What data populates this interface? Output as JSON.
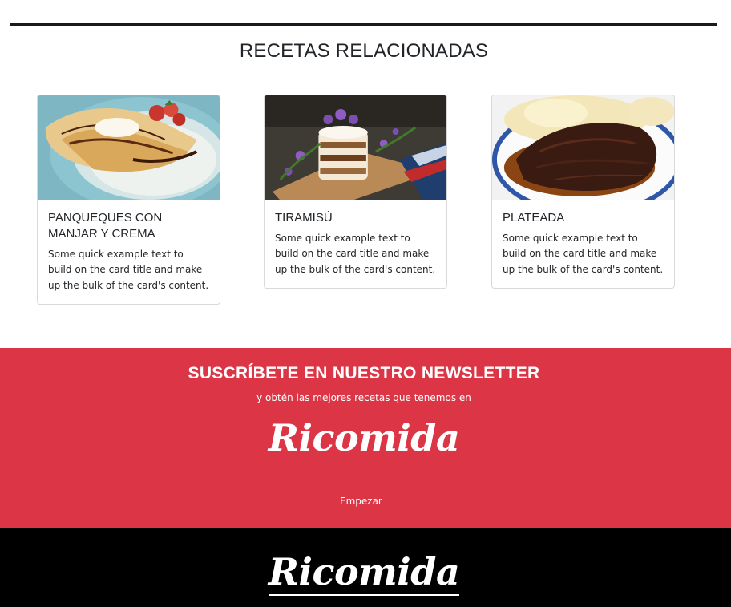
{
  "section": {
    "title": "RECETAS RELACIONADAS"
  },
  "cards": [
    {
      "title": "PANQUEQUES CON MANJAR Y CREMA",
      "text": "Some quick example text to build on the card title and make up the bulk of the card's content."
    },
    {
      "title": "TIRAMISÚ",
      "text": "Some quick example text to build on the card title and make up the bulk of the card's content."
    },
    {
      "title": "PLATEADA",
      "text": "Some quick example text to build on the card title and make up the bulk of the card's content."
    }
  ],
  "newsletter": {
    "title": "SUSCRÍBETE EN NUESTRO NEWSLETTER",
    "subtitle": "y obtén las mejores recetas que tenemos en",
    "brand": "Ricomida",
    "cta": "Empezar",
    "background": "#dc3545"
  },
  "footer": {
    "brand": "Ricomida",
    "background": "#000000"
  }
}
